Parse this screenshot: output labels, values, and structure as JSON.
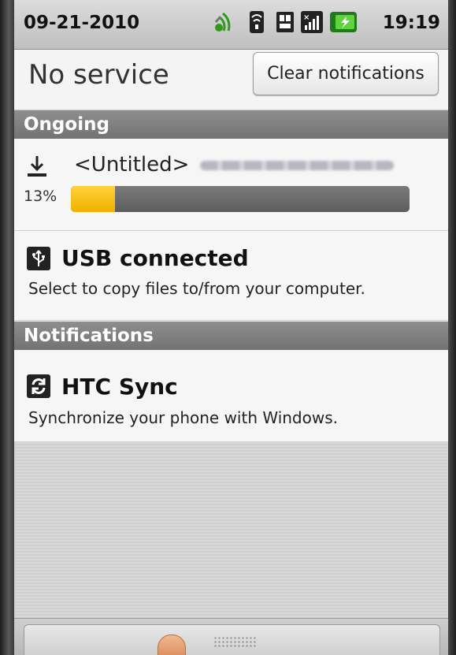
{
  "status_bar": {
    "date": "09-21-2010",
    "time": "19:19",
    "icons": [
      "sync-activity-icon",
      "wifi-icon",
      "sd-card-icon",
      "signal-off-icon",
      "battery-charging-icon"
    ]
  },
  "header": {
    "carrier_text": "No service",
    "clear_button_label": "Clear notifications"
  },
  "ongoing": {
    "section_title": "Ongoing",
    "download": {
      "title": "<Untitled>",
      "progress_label": "13%",
      "progress": 0.13,
      "accent_color": "#f5bf00"
    },
    "usb": {
      "title": "USB connected",
      "description": "Select to copy files to/from your computer."
    }
  },
  "notifications": {
    "section_title": "Notifications",
    "items": [
      {
        "title": "HTC Sync",
        "description": "Synchronize your phone with Windows."
      }
    ]
  }
}
